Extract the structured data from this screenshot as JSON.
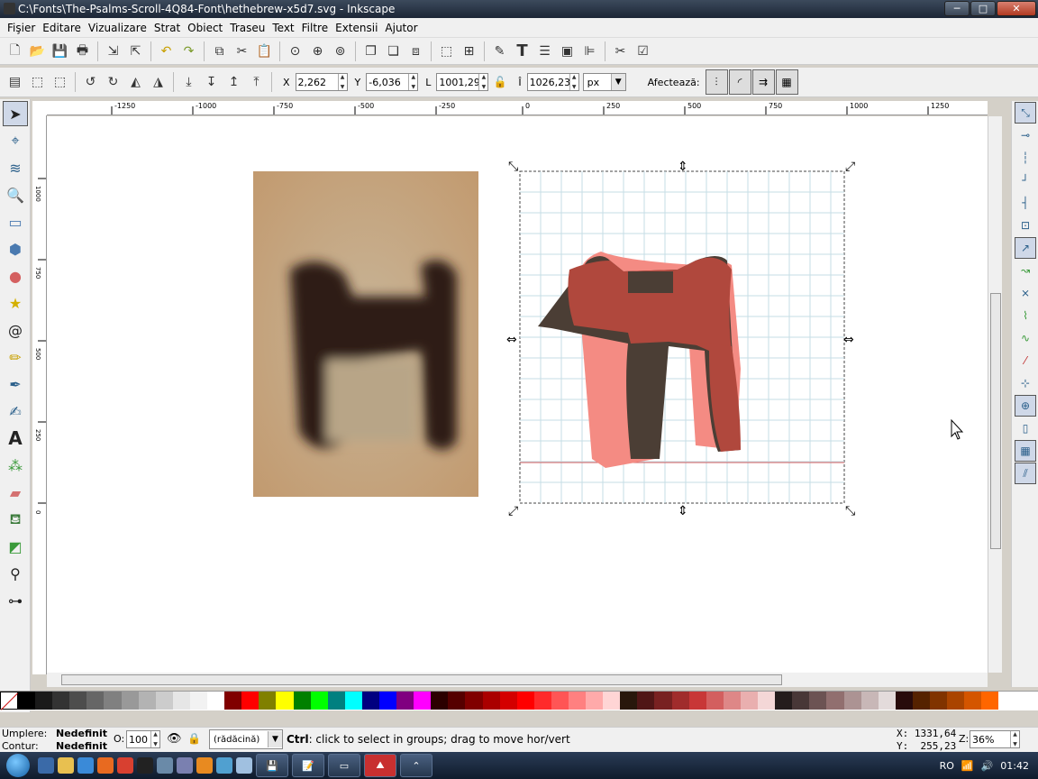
{
  "window": {
    "title": "C:\\Fonts\\The-Psalms-Scroll-4Q84-Font\\hethebrew-x5d7.svg - Inkscape",
    "min": "─",
    "max": "□",
    "close": "✕"
  },
  "menu": [
    "Fişier",
    "Editare",
    "Vizualizare",
    "Strat",
    "Obiect",
    "Traseu",
    "Text",
    "Filtre",
    "Extensii",
    "Ajutor"
  ],
  "toolbar_icons": [
    "new-icon",
    "open-icon",
    "save-icon",
    "print-icon",
    "sep",
    "import-icon",
    "export-icon",
    "sep",
    "undo-icon",
    "redo-icon",
    "sep",
    "copy-icon",
    "cut-icon",
    "paste-icon",
    "sep",
    "zoom-selection-icon",
    "zoom-drawing-icon",
    "zoom-page-icon",
    "sep",
    "duplicate-icon",
    "clone-icon",
    "unlink-clone-icon",
    "sep",
    "group-icon",
    "ungroup-icon",
    "sep",
    "fill-stroke-icon",
    "text-format-icon",
    "layers-icon",
    "xml-editor-icon",
    "align-icon",
    "sep",
    "preferences-icon",
    "document-properties-icon"
  ],
  "select_toolbar": {
    "x_label": "X",
    "x_value": "2,262",
    "y_label": "Y",
    "y_value": "-6,036",
    "w_label": "L",
    "w_value": "1001,29",
    "h_label": "Î",
    "h_value": "1026,23",
    "unit": "px",
    "affect_label": "Afectează:"
  },
  "ruler": {
    "top_ticks": [
      "-1250",
      "-1000",
      "-750",
      "-500",
      "-250",
      "0",
      "250",
      "500",
      "750",
      "1000",
      "1250"
    ],
    "left_ticks": [
      "1000",
      "750",
      "500",
      "250",
      "0"
    ]
  },
  "tools": [
    "select-tool-icon",
    "node-tool-icon",
    "tweak-tool-icon",
    "zoom-tool-icon",
    "rect-tool-icon",
    "3dbox-tool-icon",
    "ellipse-tool-icon",
    "star-tool-icon",
    "spiral-tool-icon",
    "pencil-tool-icon",
    "pen-tool-icon",
    "calligraphy-tool-icon",
    "text-tool-icon",
    "spray-tool-icon",
    "eraser-tool-icon",
    "paint-bucket-tool-icon",
    "gradient-tool-icon",
    "dropper-tool-icon",
    "connector-tool-icon"
  ],
  "snap_icons": [
    "snap-enable-icon",
    "snap-bbox-icon",
    "snap-bbox-edge-icon",
    "snap-bbox-corner-icon",
    "snap-bbox-midpoint-icon",
    "snap-bbox-center-icon",
    "snap-nodes-icon",
    "snap-path-icon",
    "snap-intersection-icon",
    "snap-cusp-icon",
    "snap-smooth-icon",
    "snap-line-midpoint-icon",
    "snap-object-midpoint-icon",
    "snap-rotation-center-icon",
    "snap-page-border-icon",
    "snap-grid-icon",
    "snap-guide-icon"
  ],
  "palette": [
    "#000000",
    "#1a1a1a",
    "#333333",
    "#4d4d4d",
    "#666666",
    "#808080",
    "#999999",
    "#b3b3b3",
    "#cccccc",
    "#e6e6e6",
    "#f2f2f2",
    "#ffffff",
    "#800000",
    "#ff0000",
    "#808000",
    "#ffff00",
    "#008000",
    "#00ff00",
    "#008080",
    "#00ffff",
    "#000080",
    "#0000ff",
    "#800080",
    "#ff00ff",
    "#2b0000",
    "#550000",
    "#800000",
    "#aa0000",
    "#d40000",
    "#ff0000",
    "#ff2a2a",
    "#ff5555",
    "#ff8080",
    "#ffaaaa",
    "#ffd5d5",
    "#28170b",
    "#501616",
    "#782121",
    "#a02c2c",
    "#c83737",
    "#d35f5f",
    "#de8787",
    "#e9afaf",
    "#f4d7d7",
    "#241c1c",
    "#483737",
    "#6c5353",
    "#916f6f",
    "#ac9393",
    "#c8b7b7",
    "#e3dbdb",
    "#280b0b",
    "#552200",
    "#803300",
    "#aa4400",
    "#d45500",
    "#ff6600"
  ],
  "status": {
    "fill_label": "Umplere:",
    "fill_value": "Nedefinit",
    "stroke_label": "Contur:",
    "stroke_value": "Nedefinit",
    "opacity_label": "O:",
    "opacity_value": "100",
    "layer": "(rădăcină)",
    "message_key": "Ctrl",
    "message": ": click to select in groups; drag to move hor/vert",
    "x_coord": "X: 1331,64",
    "y_coord": "Y:  255,23",
    "zoom_label": "Z:",
    "zoom_value": "36%"
  },
  "taskbar": {
    "lang": "RO",
    "time": "01:42"
  }
}
